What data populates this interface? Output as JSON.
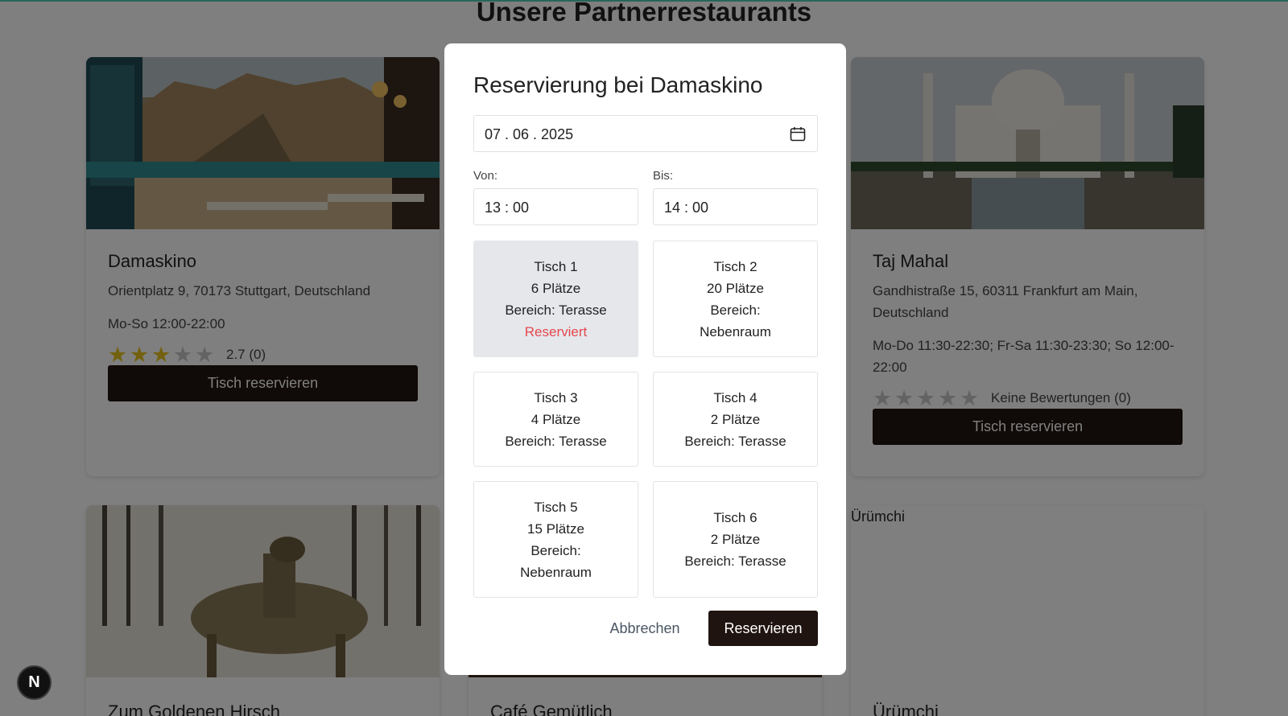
{
  "page": {
    "title": "Unsere Partnerrestaurants"
  },
  "restaurants": [
    {
      "name": "Damaskino",
      "address": "Orientplatz 9, 70173 Stuttgart, Deutschland",
      "hours": "Mo-So 12:00-22:00",
      "rating": 2.7,
      "rating_text": "2.7 (0)",
      "button_label": "Tisch reservieren"
    },
    {
      "name": "Taj Mahal",
      "address": "Gandhistraße 15, 60311 Frankfurt am Main, Deutschland",
      "hours": "Mo-Do 11:30-22:30; Fr-Sa 11:30-23:30; So 12:00-22:00",
      "rating": 0,
      "rating_text": "Keine Bewertungen (0)",
      "button_label": "Tisch reservieren"
    },
    {
      "name": "Zum Goldenen Hirsch"
    },
    {
      "name": "Café Gemütlich"
    },
    {
      "name": "Ürümchi",
      "image_alt": "Ürümchi"
    }
  ],
  "modal": {
    "title": "Reservierung bei Damaskino",
    "date": "07 . 06 . 2025",
    "from_label": "Von:",
    "from_value": "13 : 00",
    "to_label": "Bis:",
    "to_value": "14 : 00",
    "tables": [
      {
        "name": "Tisch 1",
        "seats": "6 Plätze",
        "area": "Bereich: Terasse",
        "status": "Reserviert",
        "selected": true
      },
      {
        "name": "Tisch 2",
        "seats": "20 Plätze",
        "area_label": "Bereich:",
        "area_value": "Nebenraum"
      },
      {
        "name": "Tisch 3",
        "seats": "4 Plätze",
        "area": "Bereich: Terasse"
      },
      {
        "name": "Tisch 4",
        "seats": "2 Plätze",
        "area": "Bereich: Terasse"
      },
      {
        "name": "Tisch 5",
        "seats": "15 Plätze",
        "area_label": "Bereich:",
        "area_value": "Nebenraum"
      },
      {
        "name": "Tisch 6",
        "seats": "2 Plätze",
        "area": "Bereich: Terasse"
      }
    ],
    "cancel_label": "Abbrechen",
    "submit_label": "Reservieren"
  },
  "fab": {
    "label": "N"
  },
  "colors": {
    "accent": "#201410",
    "reserved": "#e5484d",
    "star": "#e7c21f"
  }
}
